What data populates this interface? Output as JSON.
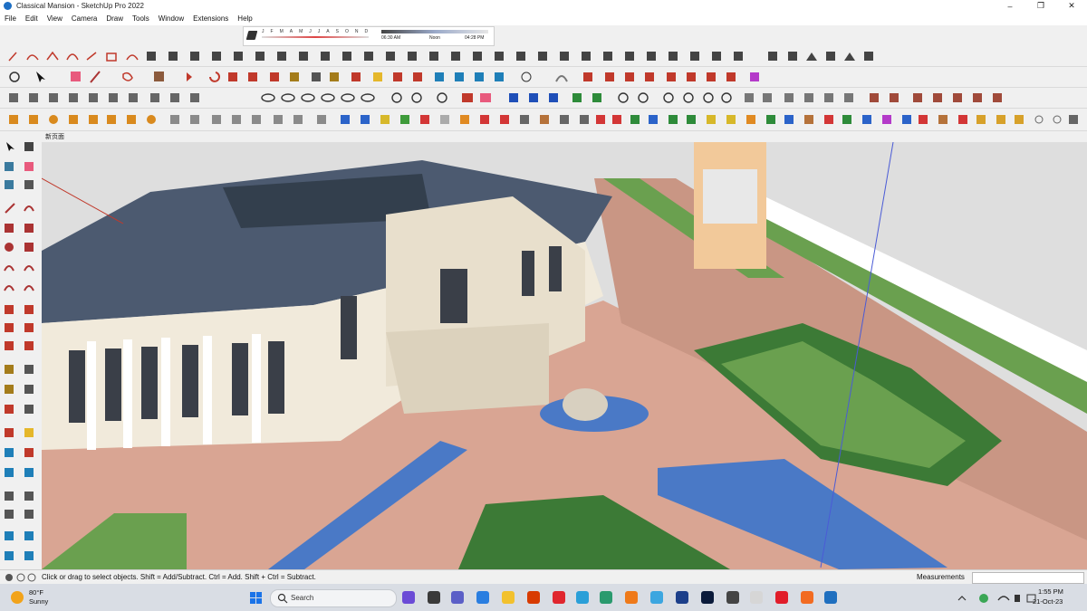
{
  "window": {
    "title": "Classical Mansion - SketchUp Pro 2022",
    "min": "–",
    "max": "❐",
    "close": "✕"
  },
  "menu": [
    "File",
    "Edit",
    "View",
    "Camera",
    "Draw",
    "Tools",
    "Window",
    "Extensions",
    "Help"
  ],
  "shadow": {
    "months": [
      "J",
      "F",
      "M",
      "A",
      "M",
      "J",
      "J",
      "A",
      "S",
      "O",
      "N",
      "D"
    ],
    "t_start": "06:30 AM",
    "t_mid": "Noon",
    "t_end": "04:28 PM"
  },
  "tab": {
    "label": "新页面"
  },
  "status": {
    "message": "Click or drag to select objects. Shift = Add/Subtract. Ctrl = Add. Shift + Ctrl = Subtract.",
    "measurements_label": "Measurements",
    "measurements_value": ""
  },
  "taskbar": {
    "temp": "80°F",
    "condition": "Sunny",
    "search_placeholder": "Search",
    "time": "1:55 PM",
    "date": "21-Oct-23"
  },
  "colors": {
    "sky": "#dedede",
    "paving": "#d9a593",
    "grass": "#6aa04f",
    "roof": "#4c5a70",
    "water": "#4a79c6",
    "building": "#f1eadb"
  }
}
